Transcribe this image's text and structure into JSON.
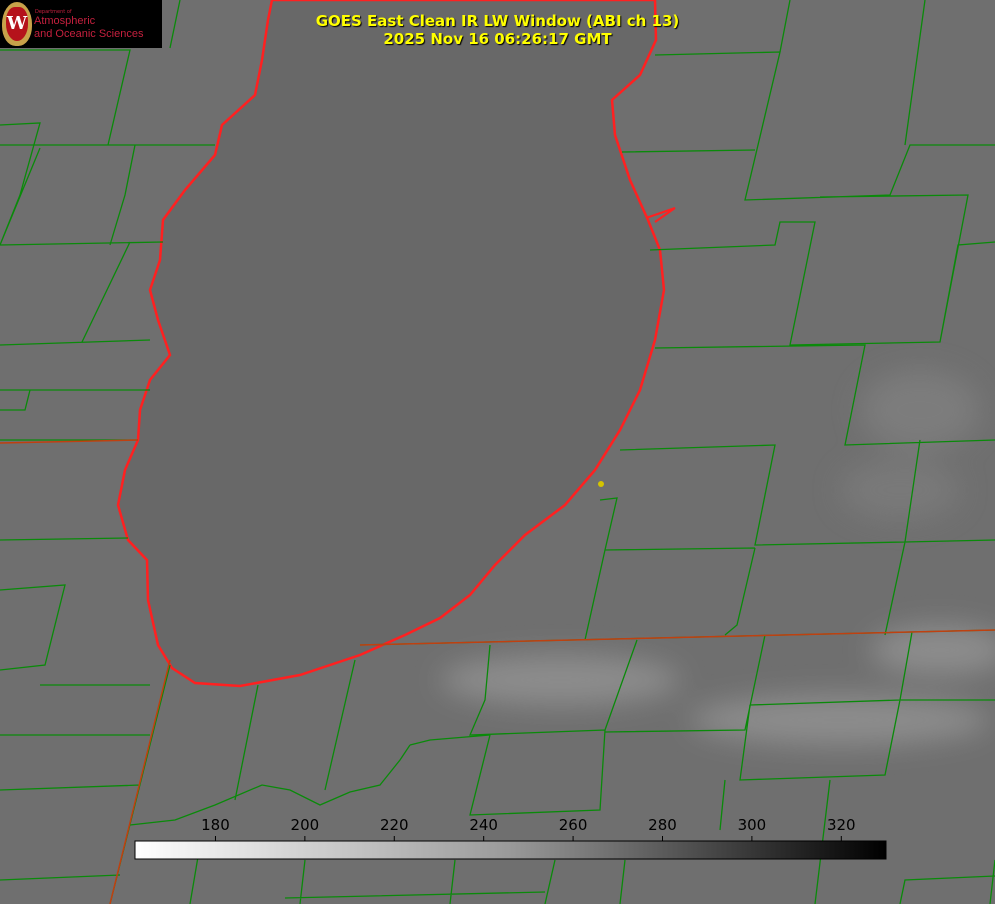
{
  "title": {
    "line1": "GOES East Clean IR LW Window (ABI ch 13)",
    "line2": "2025 Nov 16 06:26:17 GMT"
  },
  "logo": {
    "dept": "Department of",
    "line1": "Atmospheric",
    "line2": "and Oceanic Sciences",
    "seal_letter": "W"
  },
  "colorbar": {
    "ticks": [
      180,
      200,
      220,
      240,
      260,
      280,
      300,
      320
    ],
    "range": [
      162,
      330
    ],
    "colors": {
      "low": "#ffffff",
      "high": "#000000"
    }
  },
  "colors": {
    "background": "#6f6f6f",
    "lake": "#696969",
    "county_lines": "#0a8a0a",
    "shoreline": "#ff2020",
    "marker": "#d4c400"
  }
}
